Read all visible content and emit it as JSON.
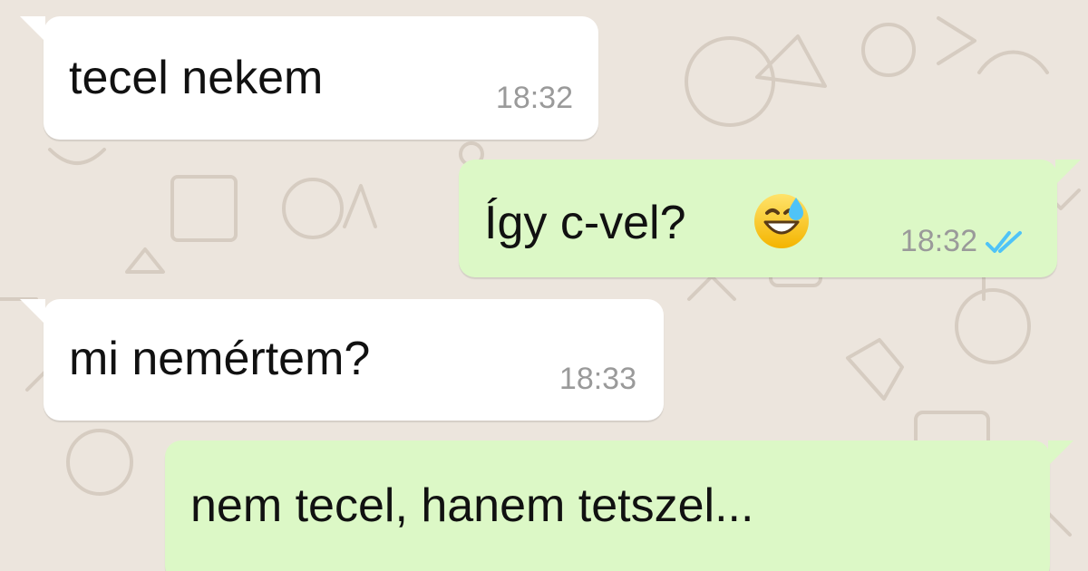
{
  "theme": {
    "wallpaper": "#ece5dd",
    "incoming_bubble": "#ffffff",
    "outgoing_bubble": "#dcf8c6",
    "read_ticks": "#4fc3f7",
    "time_color": "#9a9a9a"
  },
  "messages": [
    {
      "direction": "incoming",
      "text": "tecel nekem",
      "time": "18:32"
    },
    {
      "direction": "outgoing",
      "text": "Így c-vel?",
      "emoji": "grinning-face-with-sweat-icon",
      "time": "18:32",
      "status": "read-double-check-icon"
    },
    {
      "direction": "incoming",
      "text": "mi nemértem?",
      "time": "18:33"
    },
    {
      "direction": "outgoing",
      "text": "nem tecel, hanem tetszel..."
    }
  ]
}
